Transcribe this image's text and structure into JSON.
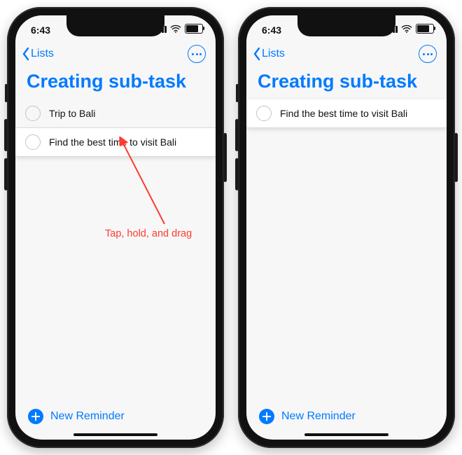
{
  "status": {
    "time": "6:43"
  },
  "nav": {
    "back_label": "Lists"
  },
  "page": {
    "title": "Creating sub-task"
  },
  "phone1": {
    "items": [
      {
        "label": "Trip to Bali"
      },
      {
        "label": "Find the best time to visit Bali"
      }
    ]
  },
  "phone2": {
    "items": [
      {
        "label": "Find the best time to visit Bali"
      }
    ]
  },
  "footer": {
    "new_reminder": "New Reminder"
  },
  "annotation": {
    "text": "Tap, hold, and drag"
  }
}
